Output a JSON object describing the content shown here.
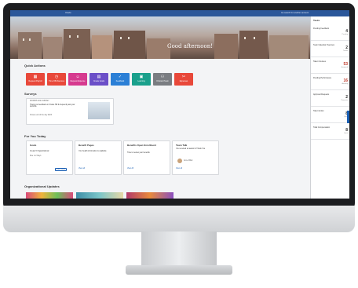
{
  "topbar": {
    "title": "Oracle",
    "right_text": "Go search for another account"
  },
  "hero": {
    "greeting": "Good afternoon!"
  },
  "quick_actions": {
    "title": "Quick Actions",
    "items": [
      {
        "label": "Request Payroll",
        "color": "#e8483a",
        "icon": "calendar-icon"
      },
      {
        "label": "Time Off Absences",
        "color": "#e8483a",
        "icon": "clock-icon"
      },
      {
        "label": "Request Expense",
        "color": "#d63a8f",
        "icon": "people-icon"
      },
      {
        "label": "Create Goals",
        "color": "#6b4fc8",
        "icon": "doc-icon"
      },
      {
        "label": "Feedback",
        "color": "#2b7fd6",
        "icon": "thumb-icon"
      },
      {
        "label": "Learning",
        "color": "#1aa08c",
        "icon": "book-icon"
      },
      {
        "label": "Onboard Team",
        "color": "#7a7d82",
        "icon": "handshake-icon"
      },
      {
        "label": "Expenses",
        "color": "#e8483a",
        "icon": "tools-icon"
      }
    ]
  },
  "surveys": {
    "title": "Surveys",
    "card": {
      "head": "WORKPLACE SURVEY",
      "body": "Thank you feedback on Oracle HR & frequently ask your work life.",
      "meta": "Closes end of the day 2023"
    }
  },
  "for_you": {
    "title": "For You Today",
    "cards": [
      {
        "title": "Goals",
        "sub": "Create 5 Organizational",
        "meta": "Due in 2 Days",
        "action": "View Goals"
      },
      {
        "title": "Benefit Pages",
        "sub": "Your health information is available",
        "meta": "Review",
        "action": "View all"
      },
      {
        "title": "Benefits Open Enrollment",
        "sub": "Time to review your benefits",
        "meta": "Enrollment window",
        "action": "View All"
      },
      {
        "title": "Team Talk",
        "sub": "You received an award in Thank You",
        "meta": "Anne Miller",
        "action": "View all"
      }
    ]
  },
  "org_updates": {
    "title": "Organizational Updates"
  },
  "sidebar": {
    "title": "Tasks",
    "items": [
      {
        "label": "Pending Feedback",
        "count": "4",
        "unit": "Pending",
        "color": "#333333"
      },
      {
        "label": "Team Calendar Overview",
        "count": "2",
        "unit": "Teams",
        "color": "#333333"
      },
      {
        "label": "Talent Courses",
        "count": "53",
        "unit": "Assigned",
        "color": "#c0392b"
      },
      {
        "label": "Pending Performance",
        "count": "16",
        "unit": "Awaiting",
        "color": "#c0392b"
      },
      {
        "label": "Approval Requests",
        "count": "2",
        "unit": "Requests",
        "color": "#333333"
      },
      {
        "label": "Talent Action",
        "count": "8",
        "unit": "Open",
        "color": "#333333"
      },
      {
        "label": "Total Compensation",
        "count": "8",
        "unit": "Open",
        "color": "#333333"
      }
    ]
  }
}
